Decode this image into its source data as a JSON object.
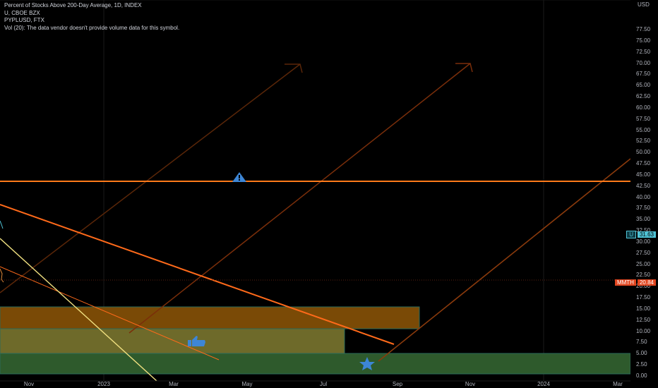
{
  "legend": {
    "line1": "Percent of Stocks Above 200-Day Average, 1D, INDEX",
    "line2": "U, CBOE BZX",
    "line3": "PYPLUSD, FTX",
    "line4": "Vol (20): The data vendor doesn't provide volume data for this symbol."
  },
  "price_axis": {
    "currency": "USD",
    "ticks": [
      "77.50",
      "75.00",
      "72.50",
      "70.00",
      "67.50",
      "65.00",
      "62.50",
      "60.00",
      "57.50",
      "55.00",
      "52.50",
      "50.00",
      "47.50",
      "45.00",
      "42.50",
      "40.00",
      "37.50",
      "35.00",
      "32.50",
      "30.00",
      "27.50",
      "25.00",
      "22.50",
      "20.00",
      "17.50",
      "15.00",
      "12.50",
      "10.00",
      "7.50",
      "5.00",
      "2.50",
      "0.00"
    ],
    "tick_values": [
      77.5,
      75,
      72.5,
      70,
      67.5,
      65,
      62.5,
      60,
      57.5,
      55,
      52.5,
      50,
      47.5,
      45,
      42.5,
      40,
      37.5,
      35,
      32.5,
      30,
      27.5,
      25,
      22.5,
      20,
      17.5,
      15,
      12.5,
      10,
      7.5,
      5,
      2.5,
      0
    ]
  },
  "time_axis": {
    "labels": [
      "Nov",
      "2023",
      "Mar",
      "May",
      "Jul",
      "Sep",
      "Nov",
      "2024",
      "Mar"
    ]
  },
  "price_tags": [
    {
      "symbol": "U",
      "value": "31.63",
      "color": "#4fc3d6",
      "price": 31.63
    },
    {
      "symbol": "MMTH",
      "value": "20.84",
      "color": "#e0451f",
      "price": 20.84
    }
  ],
  "colors": {
    "horizontal_line": "#ff7a1a",
    "trend_orange": "#ff6a1a",
    "arrow_dark": "#7a2e0a",
    "zone_brown": "#7a4a06",
    "zone_olive": "#6e6a2a",
    "zone_green": "#2e5a2c",
    "yellow_line": "#f0e080",
    "marker_blue": "#3d86d6"
  },
  "chart_data": {
    "type": "line",
    "horizontal_line_value": 42.5,
    "zones": [
      {
        "name": "brown-zone",
        "from": 10,
        "to": 15
      },
      {
        "name": "olive-zone",
        "from": 5,
        "to": 10
      },
      {
        "name": "green-zone",
        "from": 0.5,
        "to": 5
      }
    ],
    "ylim": [
      0,
      80
    ]
  },
  "icons": {
    "warning_marker": "warning-triangle-icon",
    "thumbs_up_marker": "thumbs-up-icon",
    "star_marker": "star-icon"
  }
}
